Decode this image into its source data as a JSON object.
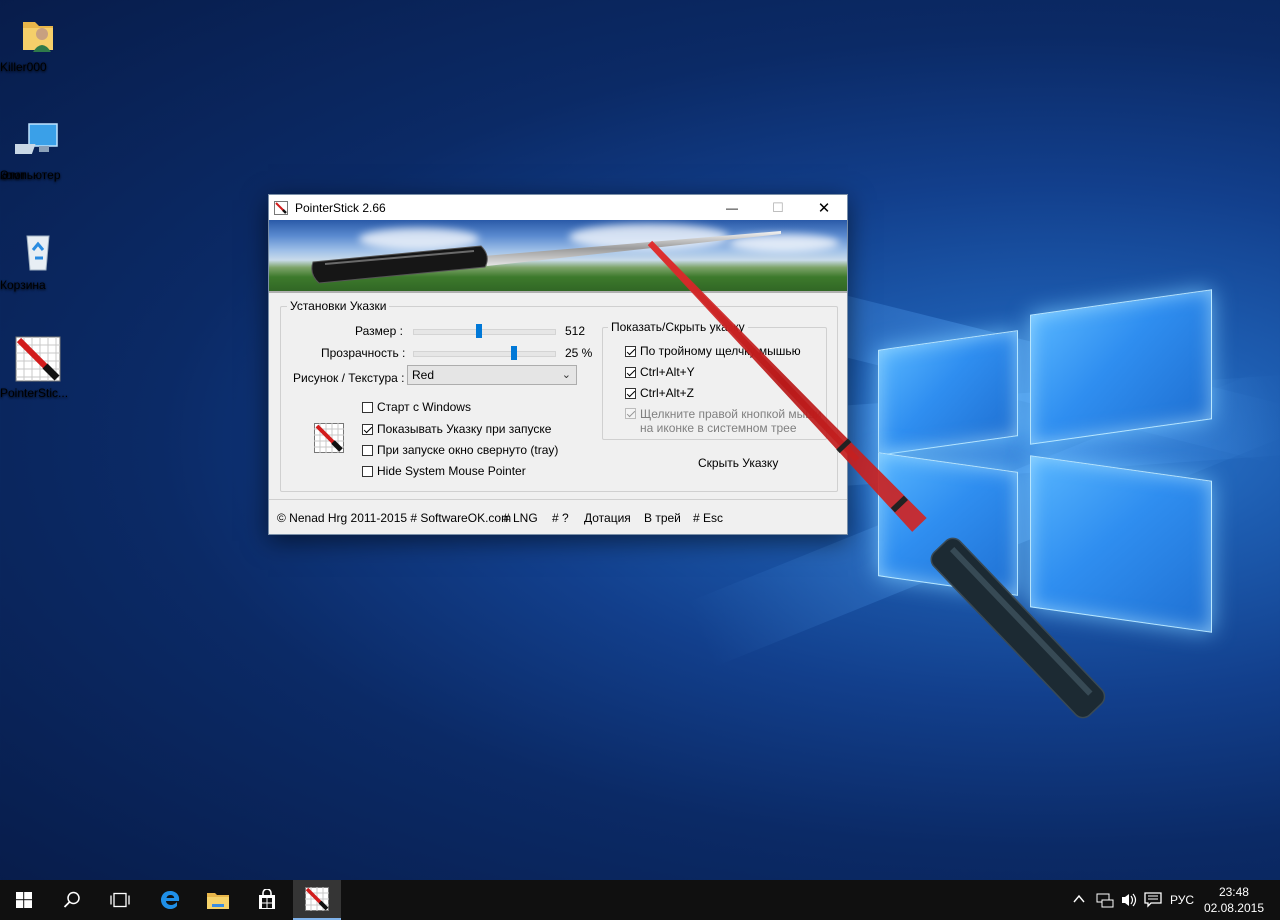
{
  "desktop": {
    "icons": [
      {
        "label": "Killer000",
        "icon": "user-folder-icon"
      },
      {
        "label": "Этот\nкомпьютер",
        "label_line1": "Этот",
        "label_line2": "компьютер",
        "icon": "computer-icon"
      },
      {
        "label": "Корзина",
        "icon": "recycle-bin-icon"
      },
      {
        "label": "PointerStic...",
        "icon": "pointerstick-icon"
      }
    ]
  },
  "window": {
    "title": "PointerStick 2.66",
    "minimize_label": "—",
    "maximize_label": "☐",
    "close_label": "✕",
    "settings_group": {
      "title": "Установки Указки",
      "size_label": "Размер :",
      "size_value": "512",
      "size_fraction": 0.47,
      "opacity_label": "Прозрачность :",
      "opacity_value": "25 %",
      "opacity_fraction": 0.72,
      "texture_label": "Рисунок / Текстура :",
      "texture_selected": "Red",
      "options": [
        {
          "label": "Старт с Windows",
          "checked": false
        },
        {
          "label": "Показывать Указку при запуске",
          "checked": true
        },
        {
          "label": "При запуске окно свернуто (tray)",
          "checked": false
        },
        {
          "label": "Hide System Mouse Pointer",
          "checked": false
        }
      ]
    },
    "show_hide_group": {
      "title": "Показать/Скрыть указку",
      "options": [
        {
          "label": "По тройному щелчку мышью",
          "checked": true
        },
        {
          "label": "Ctrl+Alt+Y",
          "checked": true
        },
        {
          "label": "Ctrl+Alt+Z",
          "checked": true
        }
      ],
      "tray_option": {
        "line1": "Щелкните правой кнопкой мыши",
        "line2": "на иконке в системном трее",
        "checked": true,
        "disabled": true
      }
    },
    "hide_button": "Скрыть Указку",
    "links": {
      "copyright": "© Nenad Hrg 2011-2015 # SoftwareOK.com",
      "lng": "# LNG",
      "help": "# ?",
      "donate": "Дотация",
      "tray": "В трей",
      "esc": "# Esc"
    }
  },
  "taskbar": {
    "start_icon": "windows-start-icon",
    "search_icon": "search-icon",
    "task_view_icon": "task-view-icon",
    "apps": [
      "edge-icon",
      "file-explorer-icon",
      "store-icon",
      "pointerstick-icon"
    ],
    "tray": {
      "language": "РУС",
      "time": "23:48",
      "date": "02.08.2015"
    }
  },
  "colors": {
    "accent": "#0078d7",
    "stick_red": "#c41e1e",
    "taskbar_bg": "#101010"
  }
}
